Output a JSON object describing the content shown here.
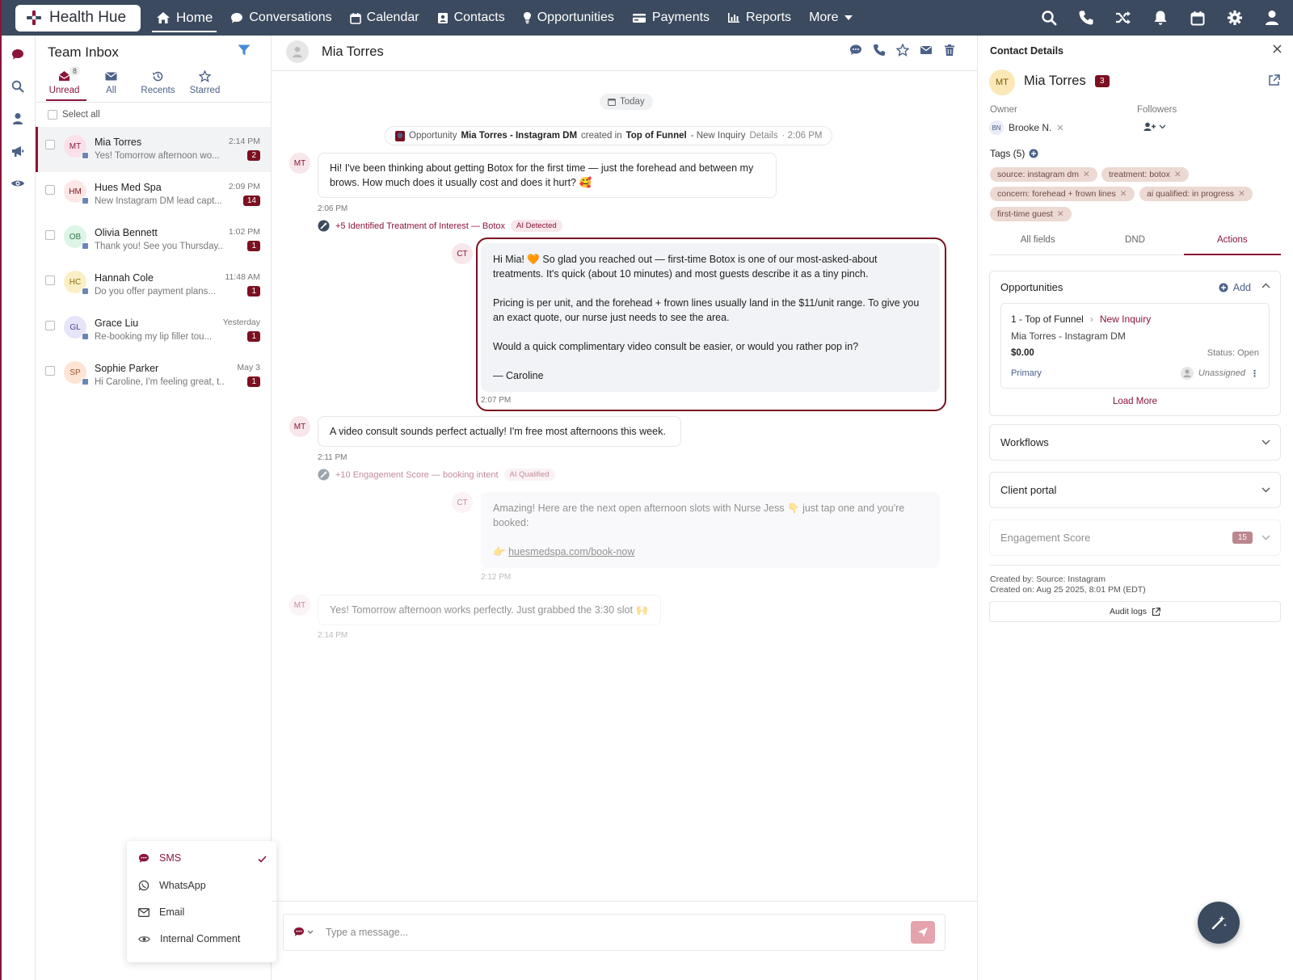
{
  "brand": {
    "name": "Health Hue",
    "accent": "#8a1538",
    "nav_bg": "#3b4a5e"
  },
  "nav": {
    "home": "Home",
    "conversations": "Conversations",
    "calendar": "Calendar",
    "contacts": "Contacts",
    "opportunities": "Opportunities",
    "payments": "Payments",
    "reports": "Reports",
    "more": "More"
  },
  "inbox": {
    "title": "Team Inbox",
    "unread_count": "8",
    "tabs": [
      {
        "label": "Unread",
        "icon": "envelope-open-icon"
      },
      {
        "label": "All",
        "icon": "envelope-icon"
      },
      {
        "label": "Recents",
        "icon": "history-icon"
      },
      {
        "label": "Starred",
        "icon": "star-icon"
      }
    ],
    "select_all": "Select all",
    "conversations": [
      {
        "initials": "MT",
        "name": "Mia Torres",
        "snippet": "Yes! Tomorrow afternoon wo...",
        "time": "2:14 PM",
        "count": "2",
        "color": "#fbe0ea",
        "text_color": "#8a1538"
      },
      {
        "initials": "HM",
        "name": "Hues Med Spa",
        "snippet": "New Instagram DM lead capt...",
        "time": "2:09 PM",
        "count": "14",
        "color": "#fde7e7",
        "text_color": "#7a1020"
      },
      {
        "initials": "OB",
        "name": "Olivia Bennett",
        "snippet": "Thank you! See you Thursday...",
        "time": "1:02 PM",
        "count": "1",
        "color": "#dcf5e6",
        "text_color": "#2f7a4d"
      },
      {
        "initials": "HC",
        "name": "Hannah Cole",
        "snippet": "Do you offer payment plans...",
        "time": "11:48 AM",
        "count": "1",
        "color": "#fbefc6",
        "text_color": "#8a6d00"
      },
      {
        "initials": "GL",
        "name": "Grace Liu",
        "snippet": "Re-booking my lip filler tou...",
        "time": "Yesterday",
        "count": "1",
        "color": "#e6e4f8",
        "text_color": "#4a4a9a"
      },
      {
        "initials": "SP",
        "name": "Sophie Parker",
        "snippet": "Hi Caroline, I'm feeling great, t...",
        "time": "May 3",
        "count": "1",
        "color": "#fde4d4",
        "text_color": "#a0522d"
      }
    ]
  },
  "channel_menu": {
    "items": [
      {
        "label": "SMS",
        "icon": "sms-icon",
        "selected": true
      },
      {
        "label": "WhatsApp",
        "icon": "whatsapp-icon",
        "selected": false
      },
      {
        "label": "Email",
        "icon": "email-icon",
        "selected": false
      },
      {
        "label": "Internal Comment",
        "icon": "eye-icon",
        "selected": false
      }
    ]
  },
  "chat": {
    "contact_name": "Mia Torres",
    "today_label": "Today",
    "opportunity_event": {
      "prefix": "Opportunity",
      "name": "Mia Torres - Instagram DM",
      "created_in": "created in",
      "stage": "Top of Funnel",
      "status": "- New Inquiry",
      "details": "Details",
      "time": "· 2:06 PM"
    },
    "messages": [
      {
        "initials": "MT",
        "lines": [
          "Hi! I've been thinking about getting Botox for the first time — just the forehead and between my",
          "brows. How much does it usually cost and does it hurt? 🥰"
        ],
        "time": "2:06 PM"
      },
      {
        "initials": "CT",
        "lines": [
          "Hi Mia! 🧡 So glad you reached out — first-time Botox is one of our most-asked-about",
          "treatments. It's quick (about 10 minutes) and most guests describe it as a tiny pinch.",
          "",
          "Pricing is per unit, and the forehead + frown lines usually land in the $11/unit range. To give you",
          "an exact quote, our nurse just needs to see the area.",
          "",
          "Would a quick complimentary video consult be easier, or would you rather pop in?",
          "",
          "— Caroline"
        ],
        "time": "2:07 PM"
      },
      {
        "initials": "MT",
        "lines": [
          "A video consult sounds perfect actually! I'm free most afternoons this week."
        ],
        "time": "2:11 PM"
      },
      {
        "initials": "CT",
        "lines": [
          "Amazing! Here are the next open afternoon slots with Nurse Jess 👇 just tap one and you're",
          "booked:"
        ],
        "link_prefix": "👉",
        "link": "huesmedspa.com/book-now",
        "time": "2:12 PM"
      },
      {
        "initials": "MT",
        "lines": [
          "Yes! Tomorrow afternoon works perfectly. Just grabbed the 3:30 slot 🙌"
        ],
        "time": "2:14 PM"
      }
    ],
    "ai_events": [
      {
        "text": "+5 Identified Treatment of Interest — Botox",
        "tag": "AI Detected"
      },
      {
        "text": "+10 Engagement Score — booking intent",
        "tag": "AI Qualified"
      }
    ],
    "composer_placeholder": "Type a message..."
  },
  "contact": {
    "title": "Contact Details",
    "initials": "MT",
    "name": "Mia Torres",
    "count": "3",
    "owner_label": "Owner",
    "followers_label": "Followers",
    "owner_initials": "BN",
    "owner_name": "Brooke N.",
    "tags_label": "Tags (5)",
    "tags": [
      "source: instagram dm",
      "treatment: botox",
      "concern: forehead + frown lines",
      "ai qualified: in progress",
      "first-time guest"
    ],
    "tabs": [
      "All fields",
      "DND",
      "Actions"
    ],
    "opportunities": {
      "title": "Opportunities",
      "add": "Add",
      "stage_num": "1 - Top of Funnel",
      "stage": "New Inquiry",
      "name": "Mia Torres - Instagram DM",
      "value": "$0.00",
      "status": "Status: Open",
      "primary": "Primary",
      "assignee": "Unassigned",
      "load_more": "Load More"
    },
    "workflows": "Workflows",
    "client_portal": "Client portal",
    "engagement": {
      "label": "Engagement Score",
      "value": "15"
    },
    "created_by": "Created by: Source: Instagram",
    "created_on": "Created on: Aug 25 2025, 8:01 PM (EDT)",
    "audit_logs": "Audit logs"
  }
}
